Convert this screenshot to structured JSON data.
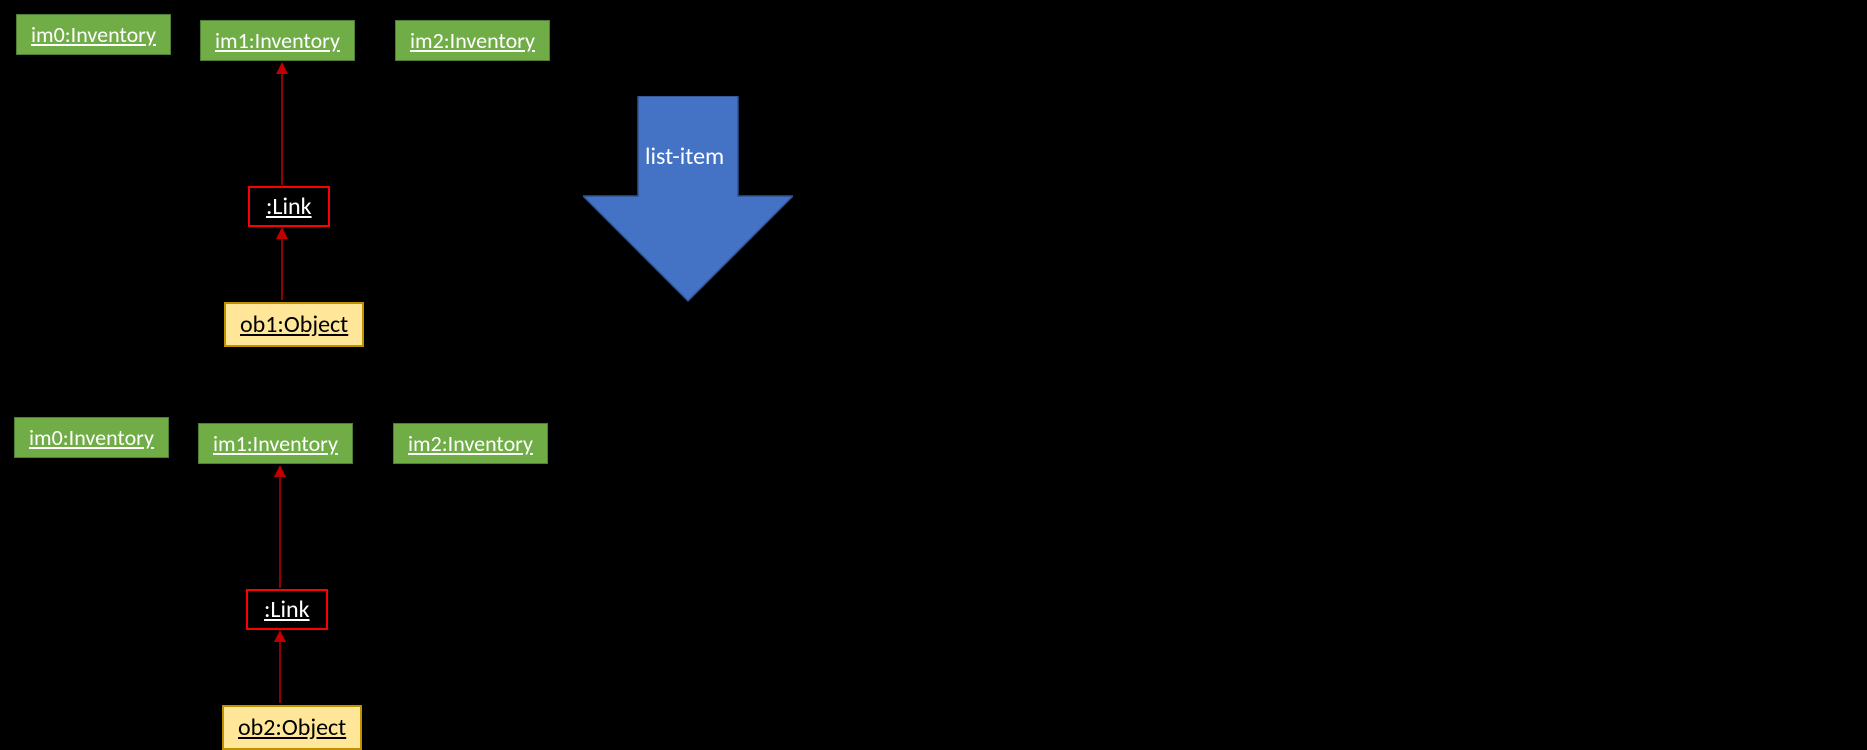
{
  "top": {
    "boxes": [
      "im0:Inventory",
      "im1:Inventory",
      "im2:Inventory"
    ],
    "link": ":Link",
    "object": "ob1:Object"
  },
  "bottom": {
    "boxes": [
      "im0:Inventory",
      "im1:Inventory",
      "im2:Inventory"
    ],
    "link": ":Link",
    "object": "ob2:Object"
  },
  "arrowLabel": "list-item",
  "colors": {
    "boxFill": "#70AD47",
    "boxBorder": "#507E34",
    "linkBorder": "#FF0000",
    "objectFill": "#FFE699",
    "objectBorder": "#BF9000",
    "blueArrow": "#4472C4",
    "redArrow": "#C00000"
  }
}
